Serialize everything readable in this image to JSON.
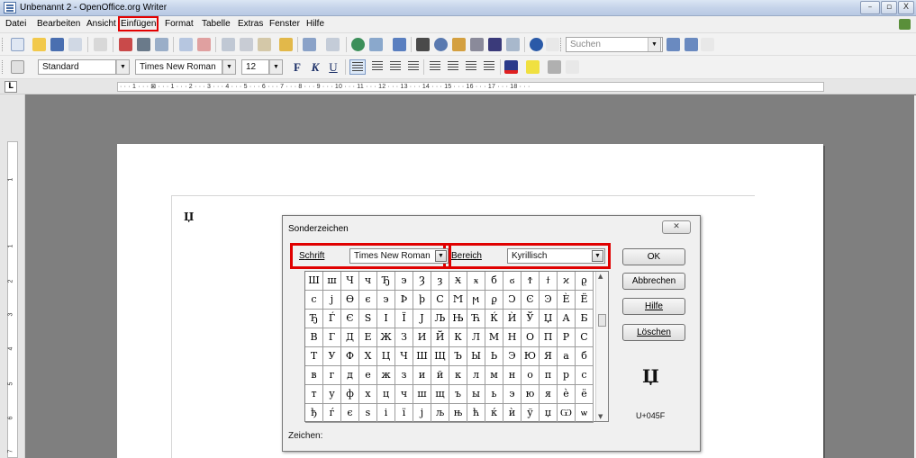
{
  "window": {
    "title": "Unbenannt 2 - OpenOffice.org Writer",
    "minimize": "–",
    "maximize": "▫",
    "close": "X"
  },
  "menu": [
    {
      "label": "Datei"
    },
    {
      "label": "Bearbeiten"
    },
    {
      "label": "Ansicht"
    },
    {
      "label": "Einfügen",
      "highlighted": true
    },
    {
      "label": "Format"
    },
    {
      "label": "Tabelle"
    },
    {
      "label": "Extras"
    },
    {
      "label": "Fenster"
    },
    {
      "label": "Hilfe"
    }
  ],
  "toolbar": {
    "search_placeholder": "Suchen",
    "paragraph_style": "Standard",
    "font_name": "Times New Roman",
    "font_size": "12",
    "bold": "F",
    "italic": "K",
    "underline": "U"
  },
  "ruler": {
    "corner": "L",
    "horizontal": "· · · 1 · · · ⊠ · · · 1 · · · 2 · · · 3 · · · 4 · · · 5 · · · 6 · · · 7 · · · 8 · · · 9 · · · 10 · · · 11 · · · 12 · · · 13 · · · 14 · · · 15 · · · 16 · · · 17 · · · 18 · · ·",
    "vertical_marks": [
      "1",
      "1",
      "2",
      "3",
      "4",
      "5",
      "6",
      "7"
    ]
  },
  "document": {
    "inserted_char": "Џ"
  },
  "dialog": {
    "title": "Sonderzeichen",
    "close": "✕",
    "font_label_u": "S",
    "font_label_rest": "chrift",
    "font_value": "Times New Roman",
    "range_label_u": "B",
    "range_label_rest": "ereich",
    "range_value": "Kyrillisch",
    "grid": [
      [
        "Ш",
        "ш",
        "Ч",
        "ч",
        "Ђ",
        "э",
        "Ȝ",
        "ȝ",
        "Ӿ",
        "ӿ",
        "б",
        "ϭ",
        "Ϯ",
        "ϯ",
        "ϰ",
        "ϱ"
      ],
      [
        "ϲ",
        "ϳ",
        "ϴ",
        "ϵ",
        "϶",
        "Ϸ",
        "ϸ",
        "Ϲ",
        "Ϻ",
        "ϻ",
        "ϼ",
        "Ͻ",
        "Ͼ",
        "Ͽ",
        "Ѐ",
        "Ё"
      ],
      [
        "Ђ",
        "Ѓ",
        "Є",
        "Ѕ",
        "І",
        "Ї",
        "Ј",
        "Љ",
        "Њ",
        "Ћ",
        "Ќ",
        "Ѝ",
        "Ў",
        "Џ",
        "А",
        "Б"
      ],
      [
        "В",
        "Г",
        "Д",
        "Е",
        "Ж",
        "З",
        "И",
        "Й",
        "К",
        "Л",
        "М",
        "Н",
        "О",
        "П",
        "Р",
        "С"
      ],
      [
        "Т",
        "У",
        "Ф",
        "Х",
        "Ц",
        "Ч",
        "Ш",
        "Щ",
        "Ъ",
        "Ы",
        "Ь",
        "Э",
        "Ю",
        "Я",
        "а",
        "б"
      ],
      [
        "в",
        "г",
        "д",
        "е",
        "ж",
        "з",
        "и",
        "й",
        "к",
        "л",
        "м",
        "н",
        "о",
        "п",
        "р",
        "с"
      ],
      [
        "т",
        "у",
        "ф",
        "х",
        "ц",
        "ч",
        "ш",
        "щ",
        "ъ",
        "ы",
        "ь",
        "э",
        "ю",
        "я",
        "ѐ",
        "ё"
      ],
      [
        "ђ",
        "ѓ",
        "є",
        "ѕ",
        "і",
        "ї",
        "ј",
        "љ",
        "њ",
        "ћ",
        "ќ",
        "ѝ",
        "ў",
        "џ",
        "Ѡ",
        "ѡ"
      ]
    ],
    "buttons": {
      "ok": "OK",
      "cancel": "Abbrechen",
      "help": "Hilfe",
      "delete": "Löschen"
    },
    "preview_char": "Џ",
    "codepoint": "U+045F",
    "characters_label": "Zeichen:"
  },
  "colors": {
    "highlight_red": "#e30000",
    "titlebar": "#c6d4ea"
  }
}
